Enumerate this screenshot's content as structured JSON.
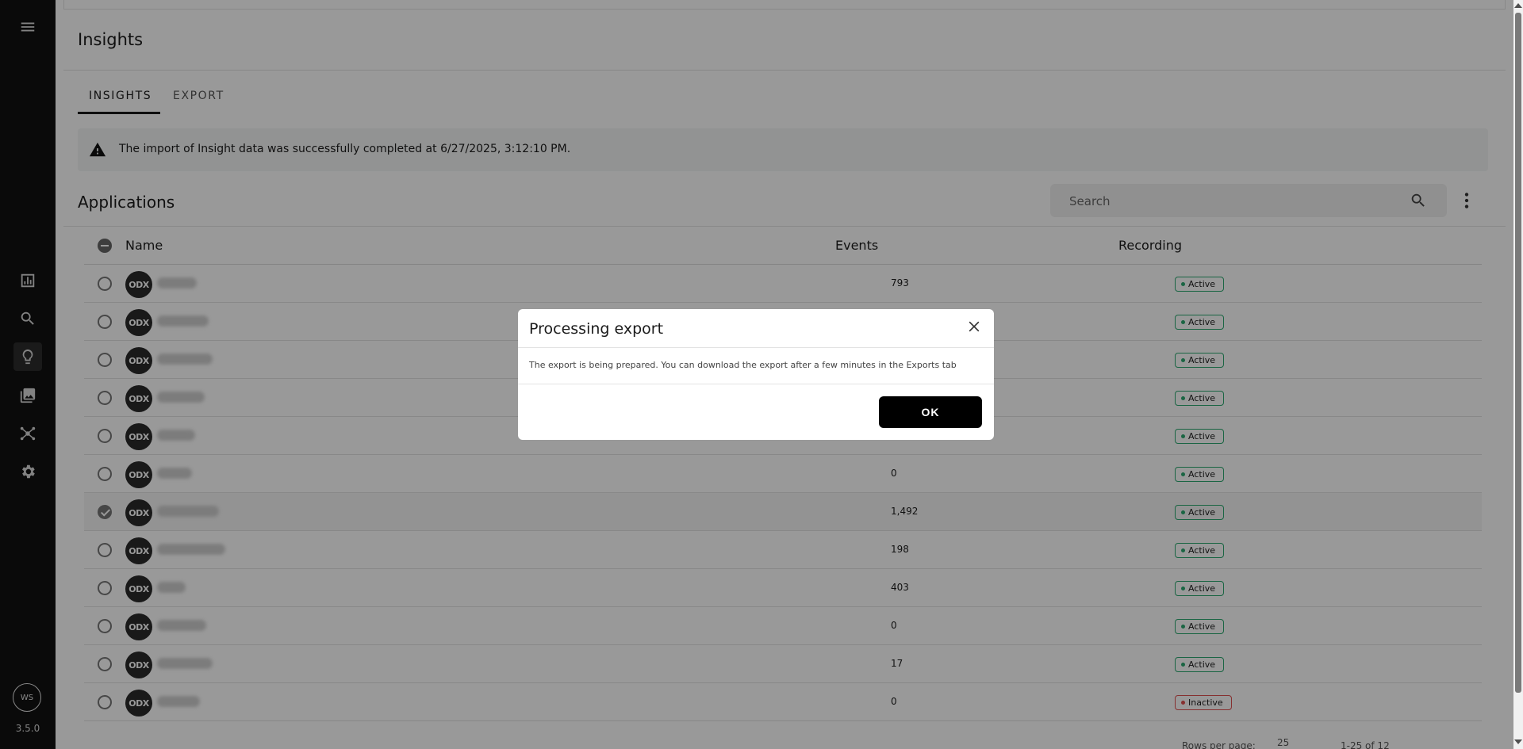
{
  "sidebar": {
    "icons": [
      "menu-icon",
      "analytics-icon",
      "search-icon",
      "insights-icon",
      "gallery-icon",
      "network-icon",
      "gear-icon"
    ],
    "avatar_initials": "WS",
    "version": "3.5.0"
  },
  "header": {
    "title": "Insights"
  },
  "tabs": [
    {
      "label": "INSIGHTS",
      "active": true
    },
    {
      "label": "EXPORT",
      "active": false
    }
  ],
  "alert": {
    "text": "The import of Insight data was successfully completed at 6/27/2025, 3:12:10 PM."
  },
  "applications": {
    "title": "Applications",
    "search_placeholder": "Search",
    "columns": [
      "Name",
      "Events",
      "Recording"
    ],
    "rows": [
      {
        "events": "793",
        "status": "Active",
        "selected": false
      },
      {
        "events": "",
        "status": "Active",
        "selected": false
      },
      {
        "events": "",
        "status": "Active",
        "selected": false
      },
      {
        "events": "",
        "status": "Active",
        "selected": false
      },
      {
        "events": "",
        "status": "Active",
        "selected": false
      },
      {
        "events": "0",
        "status": "Active",
        "selected": false
      },
      {
        "events": "1,492",
        "status": "Active",
        "selected": true
      },
      {
        "events": "198",
        "status": "Active",
        "selected": false
      },
      {
        "events": "403",
        "status": "Active",
        "selected": false
      },
      {
        "events": "0",
        "status": "Active",
        "selected": false
      },
      {
        "events": "17",
        "status": "Active",
        "selected": false
      },
      {
        "events": "0",
        "status": "Inactive",
        "selected": false
      }
    ],
    "row_avatar_text": "ODX"
  },
  "pagination": {
    "rows_per_page_label": "Rows per page:",
    "rows_per_page": "25",
    "range": "1-25 of 12"
  },
  "modal": {
    "title": "Processing export",
    "body": "The export is being prepared. You can download the export after a few minutes in the Exports tab",
    "ok_label": "OK"
  },
  "colors": {
    "active": "#2ca970",
    "inactive": "#e05050",
    "sidebar": "#111111"
  }
}
